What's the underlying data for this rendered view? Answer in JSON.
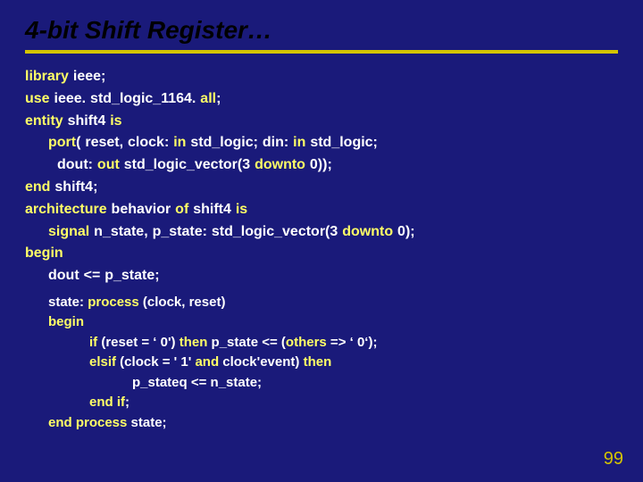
{
  "title": "4-bit Shift Register…",
  "kw": {
    "library": "library",
    "use": "use",
    "all": "all",
    "entity": "entity",
    "is": "is",
    "port": "port",
    "in": "in",
    "out": "out",
    "downto": "downto",
    "end": "end",
    "architecture": "architecture",
    "of": "of",
    "signal": "signal",
    "begin": "begin",
    "process": "process",
    "if": "if",
    "then": "then",
    "others": "others",
    "elsif": "elsif",
    "and": "and",
    "endif": "end if",
    "endprocess": "end process"
  },
  "txt": {
    "l1a": " ieee;",
    "l2a": " ieee. std_logic_1164. ",
    "l2b": ";",
    "l3a": " shift4 ",
    "l4a": "( reset, clock: ",
    "l4b": " std_logic;   din: ",
    "l4c": " std_logic;",
    "l5a": "dout: ",
    "l5b": " std_logic_vector(3 ",
    "l5c": " 0));",
    "l6a": " shift4;",
    "l7a": " behavior ",
    "l7b": " shift4 ",
    "l8a": " n_state, p_state: std_logic_vector(3 ",
    "l8b": " 0);",
    "l10a": "dout <= p_state;",
    "p1a": "state: ",
    "p1b": " (clock, reset)",
    "p3a": " (reset = ‘ 0') ",
    "p3b": "   p_state  <= (",
    "p3c": " => ‘ 0‘);",
    "p4a": " (clock = ' 1' ",
    "p4b": " clock'event) ",
    "p5a": "p_stateq <= n_state;",
    "p6a": ";",
    "p7a": " state;"
  },
  "page": "99"
}
